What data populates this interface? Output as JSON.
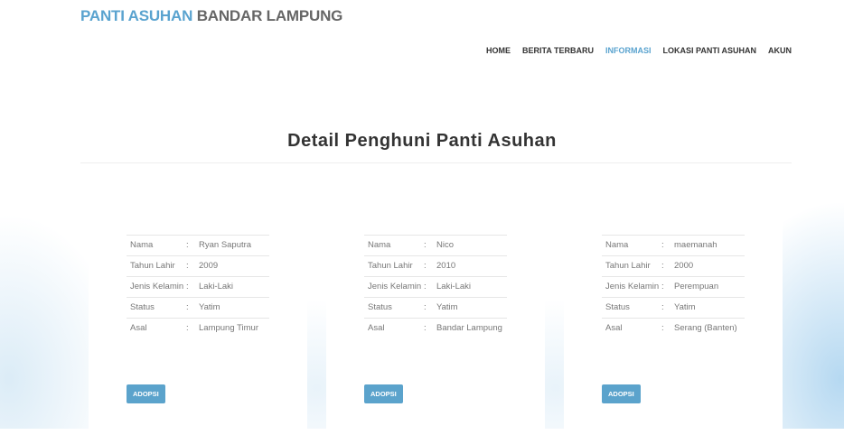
{
  "brand": {
    "part1": "PANTI ASUHAN",
    "part2": "BANDAR LAMPUNG"
  },
  "nav": [
    "HOME",
    "BERITA TERBARU",
    "INFORMASI",
    "LOKASI PANTI ASUHAN",
    "AKUN"
  ],
  "nav_active": "INFORMASI",
  "page_title": "Detail Penghuni Panti Asuhan",
  "labels": {
    "nama": "Nama",
    "tahun": "Tahun Lahir",
    "jenis": "Jenis Kelamin",
    "status": "Status",
    "asal": "Asal",
    "sep": ":"
  },
  "children": [
    {
      "nama": "Ryan Saputra",
      "tahun": "2009",
      "jenis": "Laki-Laki",
      "status": "Yatim",
      "asal": "Lampung Timur",
      "button": "ADOPSI"
    },
    {
      "nama": "Nico",
      "tahun": "2010",
      "jenis": "Laki-Laki",
      "status": "Yatim",
      "asal": "Bandar Lampung",
      "button": "ADOPSI"
    },
    {
      "nama": "maemanah",
      "tahun": "2000",
      "jenis": "Perempuan",
      "status": "Yatim",
      "asal": "Serang (Banten)",
      "button": "ADOPSI"
    }
  ],
  "colors": {
    "accent": "#5aa3cf",
    "button": "#5ba3cc",
    "brand_secondary": "#666666"
  }
}
